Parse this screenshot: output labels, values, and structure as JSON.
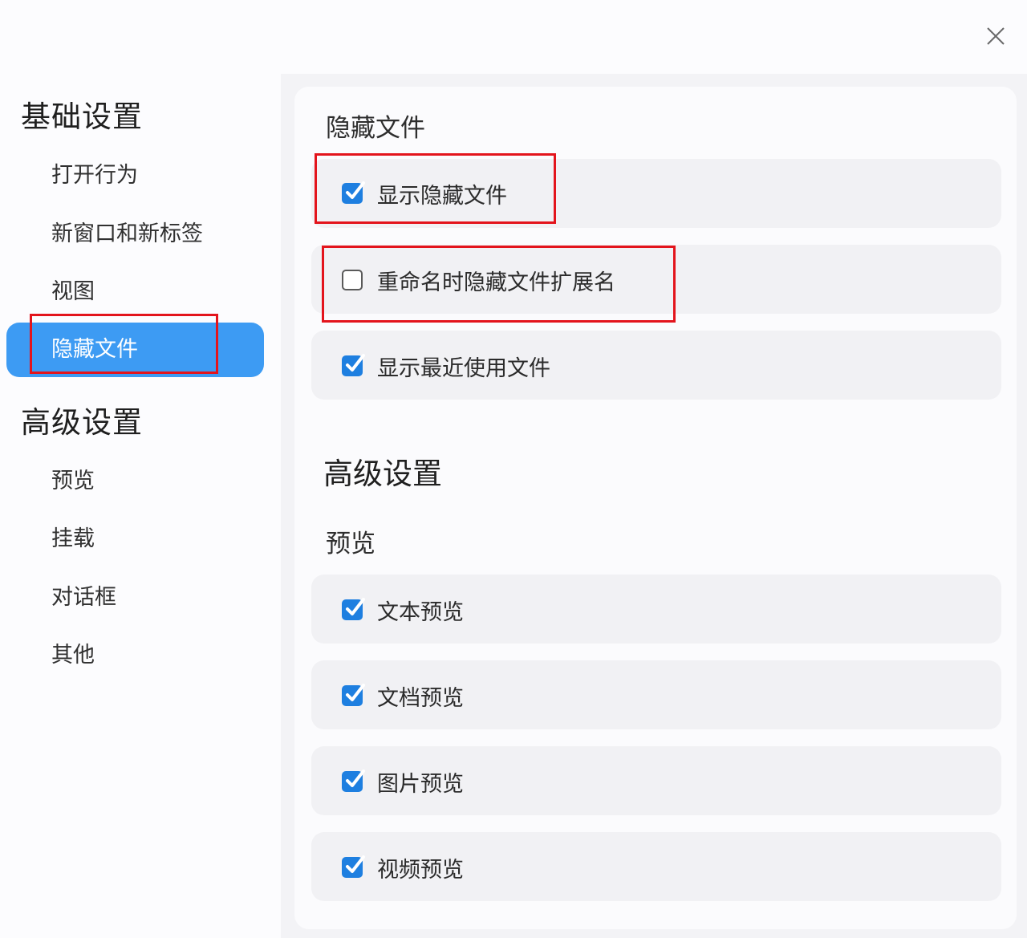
{
  "sidebar": {
    "groups": [
      {
        "title": "基础设置",
        "items": [
          {
            "label": "打开行为",
            "active": false
          },
          {
            "label": "新窗口和新标签",
            "active": false
          },
          {
            "label": "视图",
            "active": false
          },
          {
            "label": "隐藏文件",
            "active": true
          }
        ]
      },
      {
        "title": "高级设置",
        "items": [
          {
            "label": "预览",
            "active": false
          },
          {
            "label": "挂载",
            "active": false
          },
          {
            "label": "对话框",
            "active": false
          },
          {
            "label": "其他",
            "active": false
          }
        ]
      }
    ]
  },
  "content": {
    "hidden_files": {
      "label": "隐藏文件",
      "options": [
        {
          "label": "显示隐藏文件",
          "checked": true
        },
        {
          "label": "重命名时隐藏文件扩展名",
          "checked": false
        },
        {
          "label": "显示最近使用文件",
          "checked": true
        }
      ]
    },
    "advanced": {
      "title": "高级设置",
      "preview": {
        "label": "预览",
        "options": [
          {
            "label": "文本预览",
            "checked": true
          },
          {
            "label": "文档预览",
            "checked": true
          },
          {
            "label": "图片预览",
            "checked": true
          },
          {
            "label": "视频预览",
            "checked": true
          }
        ]
      }
    }
  },
  "colors": {
    "accent": "#3d9bf3",
    "checkbox": "#1e7fe0",
    "highlight_box": "#e3141c"
  },
  "icons": {
    "close": "close-icon",
    "checkmark": "checkmark-icon"
  }
}
